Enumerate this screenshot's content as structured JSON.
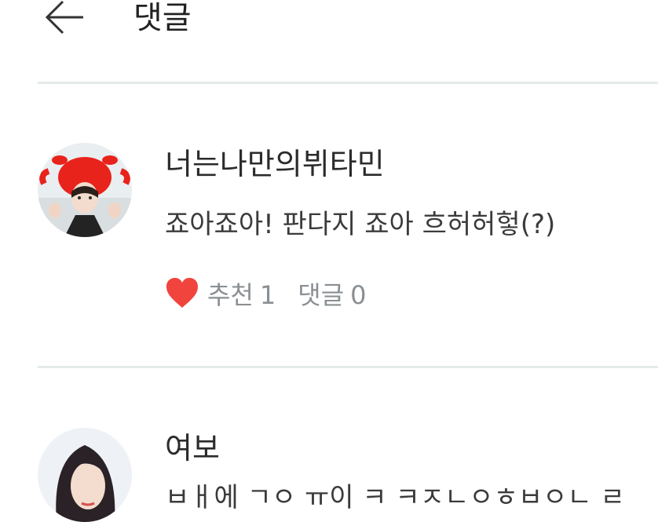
{
  "header": {
    "title": "댓글"
  },
  "comments": [
    {
      "username": "너는나만의뷔타민",
      "text": "죠아죠아! 판다지 죠아 흐허허헣(?)",
      "like_label": "추천",
      "like_count": "1",
      "reply_label": "댓글",
      "reply_count": "0"
    },
    {
      "username": "여보",
      "text": "ㅂㅐ에 ㄱㅇ ㅠ이  ㅋ  ㅋㅈㄴㅇㅎㅂㅇㄴ ㄹ"
    }
  ],
  "colors": {
    "heart": "#f0443d",
    "divider": "#e4ebe8",
    "action_text": "#8a8f93"
  }
}
